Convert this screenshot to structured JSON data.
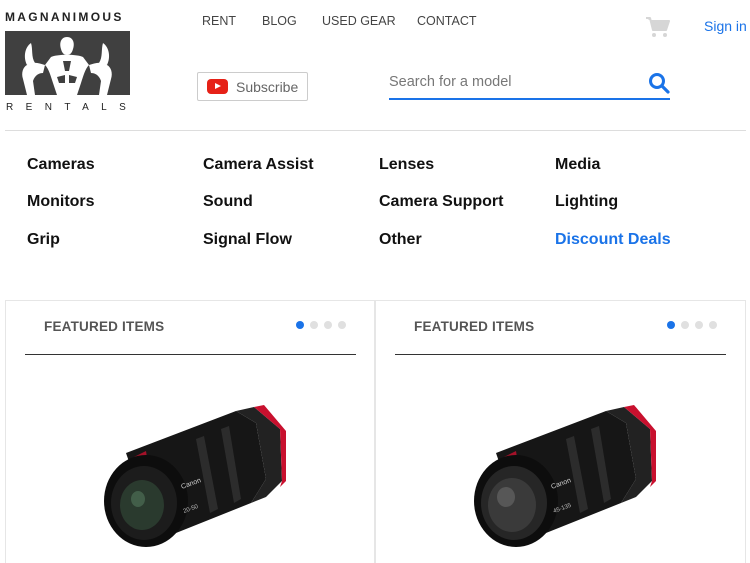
{
  "logo": {
    "top_text": "MAGNANIMOUS",
    "bottom_text": "RENTALS"
  },
  "nav": {
    "items": [
      "RENT",
      "BLOG",
      "USED GEAR",
      "CONTACT"
    ]
  },
  "header": {
    "signin_label": "Sign in",
    "subscribe_label": "Subscribe",
    "search_placeholder": "Search for a model"
  },
  "categories": [
    [
      "Cameras",
      "Camera Assist",
      "Lenses",
      "Media"
    ],
    [
      "Monitors",
      "Sound",
      "Camera Support",
      "Lighting"
    ],
    [
      "Grip",
      "Signal Flow",
      "Other",
      "Discount Deals"
    ]
  ],
  "featured": [
    {
      "title": "FEATURED ITEMS",
      "lens_label": "20-50",
      "brand": "Canon"
    },
    {
      "title": "FEATURED ITEMS",
      "lens_label": "45-135",
      "brand": "Canon"
    }
  ],
  "colors": {
    "accent": "#1a73e8",
    "logo_bg": "#404040",
    "youtube_red": "#e62117",
    "lens_red": "#c8102e"
  }
}
